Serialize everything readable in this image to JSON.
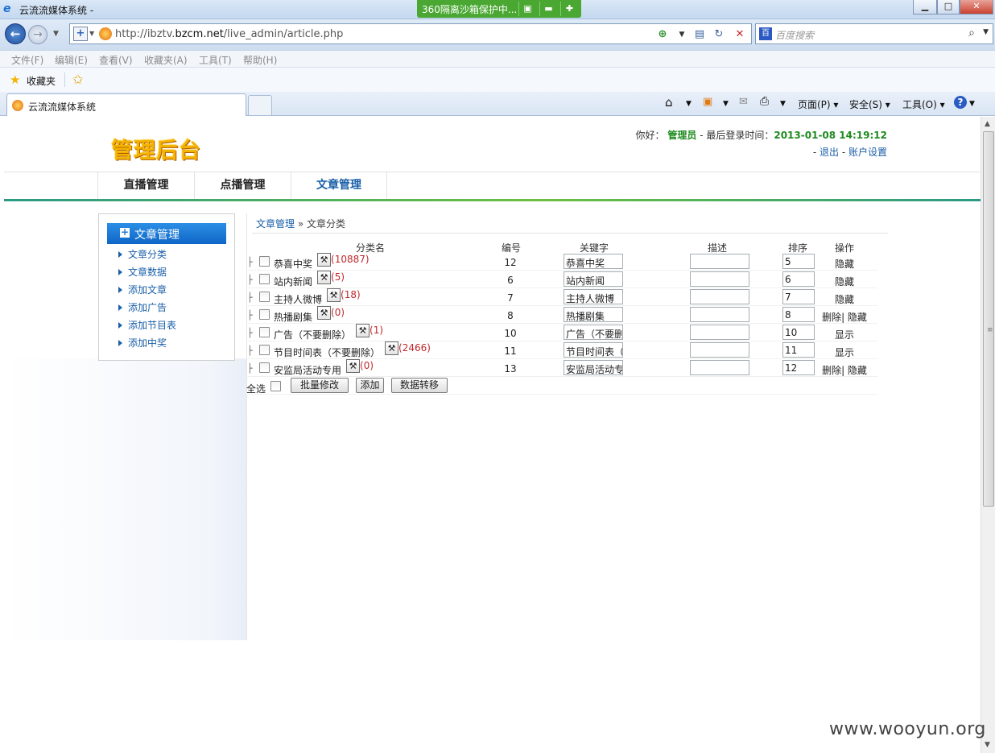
{
  "window": {
    "title": "云流流媒体系统 -",
    "sandbox_label": "360隔离沙箱保护中..."
  },
  "address": {
    "url_prefix": "http://ibztv.",
    "url_host": "bzcm.net",
    "url_path": "/live_admin/article.php"
  },
  "search": {
    "placeholder": "百度搜索"
  },
  "menu": [
    "文件(F)",
    "编辑(E)",
    "查看(V)",
    "收藏夹(A)",
    "工具(T)",
    "帮助(H)"
  ],
  "favorites": {
    "label": "收藏夹"
  },
  "tab": {
    "title": "云流流媒体系统"
  },
  "commands": {
    "page": "页面(P)",
    "safety": "安全(S)",
    "tools": "工具(O)"
  },
  "header": {
    "logo": "管理后台",
    "greeting": "你好：",
    "admin": "管理员",
    "login_label": " - 最后登录时间：",
    "login_time": "2013-01-08 14:19:12",
    "logout": "退出",
    "account": "账户设置"
  },
  "topnav": [
    "直播管理",
    "点播管理",
    "文章管理"
  ],
  "sidebar": {
    "title": "文章管理",
    "items": [
      "文章分类",
      "文章数据",
      "添加文章",
      "添加广告",
      "添加节目表",
      "添加中奖"
    ]
  },
  "breadcrumb": {
    "root": "文章管理",
    "sep": " » ",
    "current": "文章分类"
  },
  "table": {
    "headers": {
      "name": "分类名",
      "id": "编号",
      "keyword": "关键字",
      "desc": "描述",
      "sort": "排序",
      "op": "操作"
    },
    "tool_icon": "tools-icon",
    "rows": [
      {
        "name": "恭喜中奖",
        "count": "(10887)",
        "id": "12",
        "keyword": "恭喜中奖",
        "desc": "",
        "sort": "5",
        "op": "隐藏"
      },
      {
        "name": "站内新闻",
        "count": "(5)",
        "id": "6",
        "keyword": "站内新闻",
        "desc": "",
        "sort": "6",
        "op": "隐藏"
      },
      {
        "name": "主持人微博",
        "count": "(18)",
        "id": "7",
        "keyword": "主持人微博",
        "desc": "",
        "sort": "7",
        "op": "隐藏"
      },
      {
        "name": "热播剧集",
        "count": "(0)",
        "id": "8",
        "keyword": "热播剧集",
        "desc": "",
        "sort": "8",
        "op": "删除| 隐藏"
      },
      {
        "name": "广告（不要删除）",
        "count": "(1)",
        "id": "10",
        "keyword": "广告（不要删",
        "desc": "",
        "sort": "10",
        "op": "显示"
      },
      {
        "name": "节目时间表（不要删除）",
        "count": "(2466)",
        "id": "11",
        "keyword": "节目时间表（",
        "desc": "",
        "sort": "11",
        "op": "显示"
      },
      {
        "name": "安监局活动专用",
        "count": "(0)",
        "id": "13",
        "keyword": "安监局活动专",
        "desc": "",
        "sort": "12",
        "op": "删除| 隐藏"
      }
    ],
    "footer": {
      "select_all": "全选",
      "batch": "批量修改",
      "add": "添加",
      "migrate": "数据转移"
    }
  },
  "watermark": "www.wooyun.org"
}
